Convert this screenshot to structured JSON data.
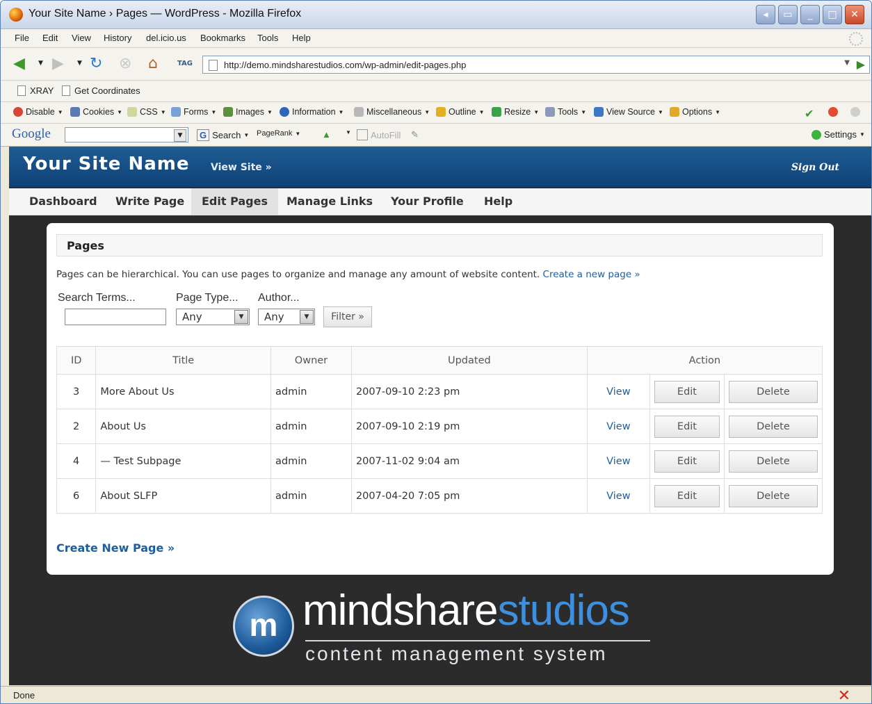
{
  "window": {
    "title": "Your Site Name › Pages — WordPress - Mozilla Firefox"
  },
  "menubar": [
    "File",
    "Edit",
    "View",
    "History",
    "del.icio.us",
    "Bookmarks",
    "Tools",
    "Help"
  ],
  "navbar": {
    "url": "http://demo.mindsharestudios.com/wp-admin/edit-pages.php",
    "tag_label": "TAG"
  },
  "bookmarks": [
    "XRAY",
    "Get Coordinates"
  ],
  "devbar": [
    "Disable",
    "Cookies",
    "CSS",
    "Forms",
    "Images",
    "Information",
    "Miscellaneous",
    "Outline",
    "Resize",
    "Tools",
    "View Source",
    "Options"
  ],
  "googlebar": {
    "logo": "Google",
    "search": "Search",
    "pagerank": "PageRank",
    "autofill": "AutoFill",
    "settings": "Settings"
  },
  "site": {
    "name": "Your Site Name",
    "view_site": "View Site »",
    "sign_out": "Sign Out"
  },
  "tabs": [
    "Dashboard",
    "Write Page",
    "Edit Pages",
    "Manage Links",
    "Your Profile",
    "Help"
  ],
  "panel": {
    "title": "Pages",
    "intro": "Pages can be hierarchical. You can use pages to organize and manage any amount of website content.",
    "intro_link": "Create a new page »",
    "filter": {
      "search_label": "Search Terms...",
      "type_label": "Page Type...",
      "author_label": "Author...",
      "type_value": "Any",
      "author_value": "Any",
      "button": "Filter »"
    },
    "table": {
      "headers": [
        "ID",
        "Title",
        "Owner",
        "Updated",
        "Action"
      ],
      "rows": [
        {
          "id": "3",
          "title": "More About Us",
          "owner": "admin",
          "updated": "2007-09-10 2:23 pm"
        },
        {
          "id": "2",
          "title": "About Us",
          "owner": "admin",
          "updated": "2007-09-10 2:19 pm"
        },
        {
          "id": "4",
          "title": "— Test Subpage",
          "owner": "admin",
          "updated": "2007-11-02 9:04 am"
        },
        {
          "id": "6",
          "title": "About SLFP",
          "owner": "admin",
          "updated": "2007-04-20 7:05 pm"
        }
      ],
      "view_label": "View",
      "edit_label": "Edit",
      "delete_label": "Delete"
    },
    "create_link": "Create New Page »"
  },
  "logo": {
    "mark": "m",
    "word_a": "mindshare",
    "word_b": "studios",
    "tagline": "content management system"
  },
  "status": {
    "text": "Done"
  }
}
